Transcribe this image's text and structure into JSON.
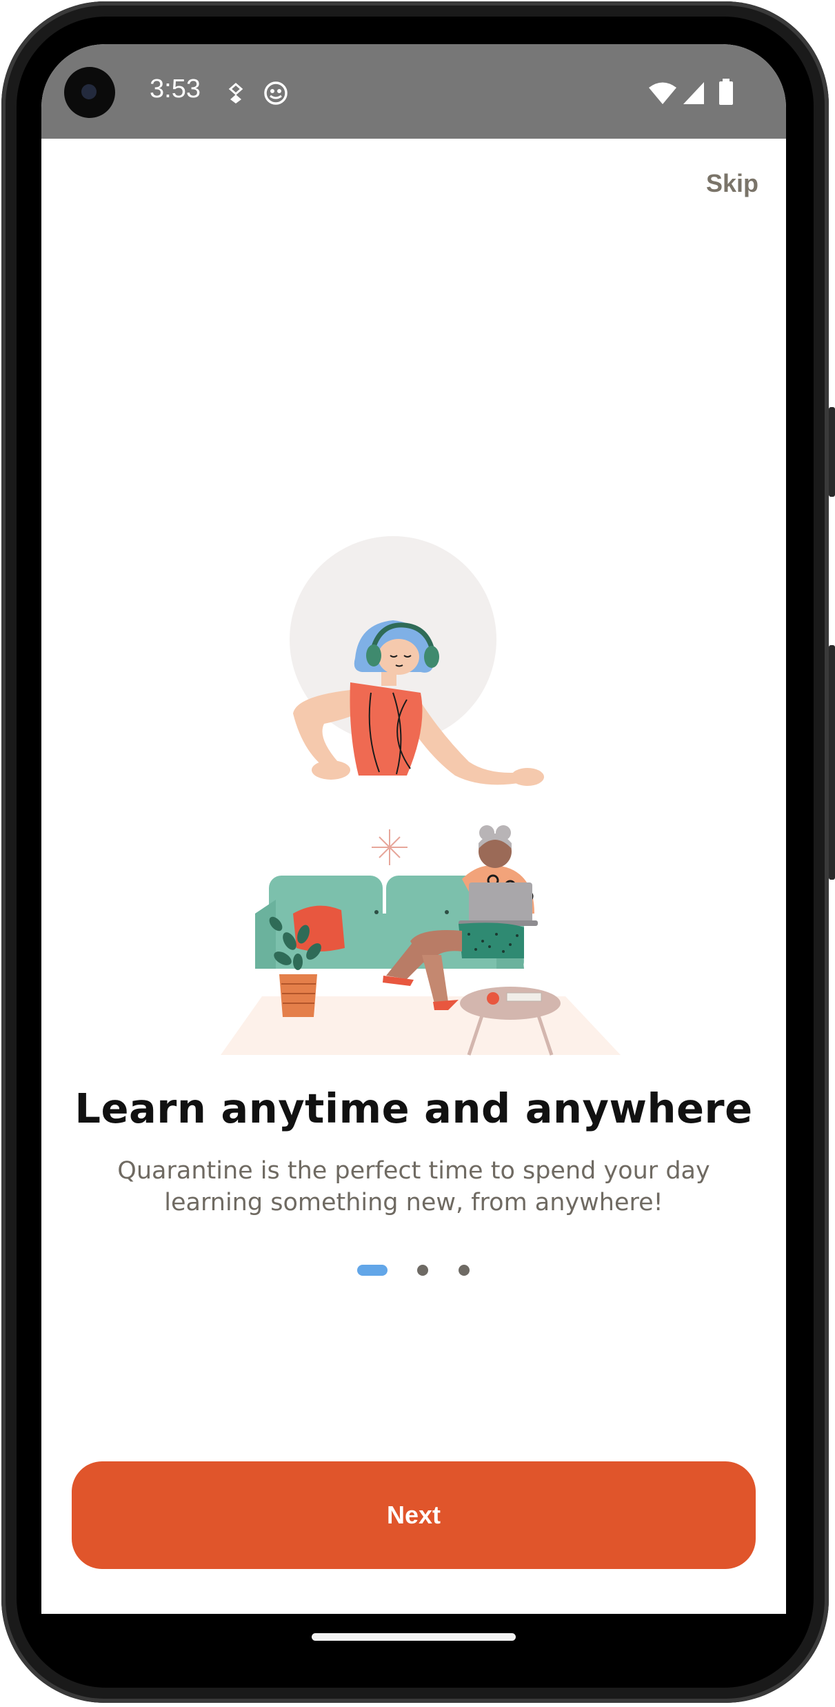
{
  "status_bar": {
    "time": "3:53",
    "icons": [
      "notification-app-icon",
      "notification-app-icon-2",
      "wifi-icon",
      "signal-icon",
      "battery-icon"
    ]
  },
  "onboarding": {
    "skip_label": "Skip",
    "title": "Learn anytime and anywhere",
    "description": "Quarantine is the perfect time to spend your day learning something new, from anywhere!",
    "page_indicator": {
      "current": 1,
      "total": 3
    },
    "next_label": "Next"
  },
  "colors": {
    "accent": "#e0552b",
    "indicator_active": "#62a6e8",
    "indicator_inactive": "#6e6a64",
    "status_bar": "#777777"
  }
}
